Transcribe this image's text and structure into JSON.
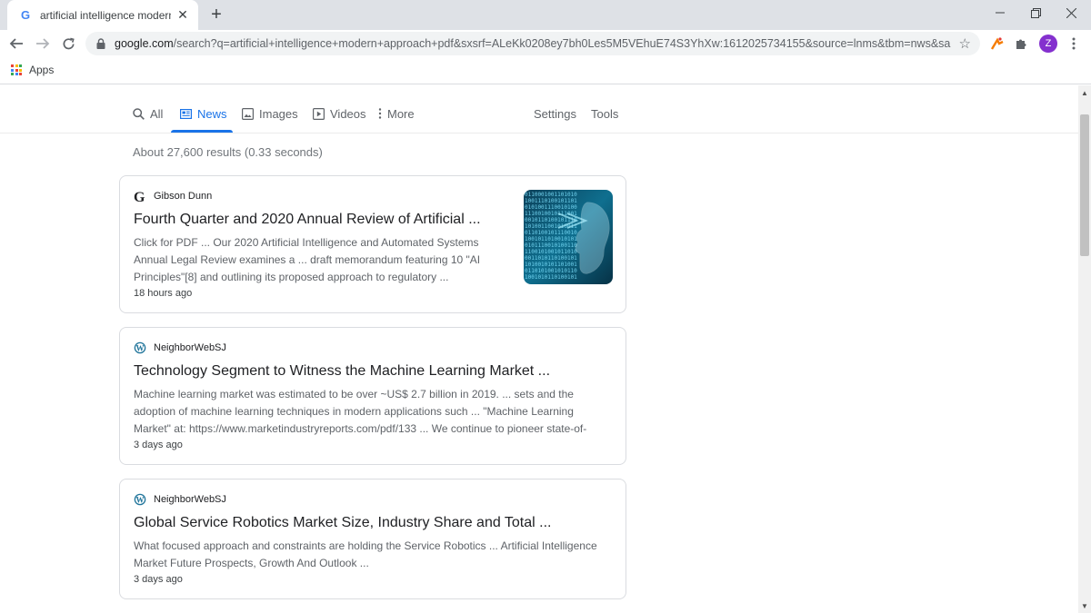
{
  "browser": {
    "tab_title": "artificial intelligence modern app",
    "tab_favicon": "G",
    "url_host": "google.com",
    "url_rest": "/search?q=artificial+intelligence+modern+approach+pdf&sxsrf=ALeKk0208ey7bh0Les5M5VEhuE74S3YhXw:1612025734155&source=lnms&tbm=nws&sa...",
    "avatar_letter": "Z",
    "bookmark_apps": "Apps"
  },
  "search_nav": {
    "items": [
      {
        "label": "All",
        "icon": "search-icon"
      },
      {
        "label": "News",
        "icon": "news-icon"
      },
      {
        "label": "Images",
        "icon": "image-icon"
      },
      {
        "label": "Videos",
        "icon": "play-icon"
      },
      {
        "label": "More",
        "icon": "more-vertical-icon"
      }
    ],
    "settings": "Settings",
    "tools": "Tools",
    "active": "News"
  },
  "results_stats": "About 27,600 results (0.33 seconds)",
  "results": [
    {
      "source": "Gibson Dunn",
      "title": "Fourth Quarter and 2020 Annual Review of Artificial ...",
      "snippet": [
        "Click for PDF ... Our 2020 Artificial Intelligence and Automated Systems",
        "Annual Legal Review examines a ... draft memorandum featuring 10 \"AI",
        "Principles\"[8] and outlining its proposed approach to regulatory ..."
      ],
      "time": "18 hours ago"
    },
    {
      "source": "NeighborWebSJ",
      "title": "Technology Segment to Witness the Machine Learning Market ...",
      "snippet": [
        "Machine learning market was estimated to be over ~US$ 2.7 billion in 2019. ... sets and the",
        "adoption of machine learning techniques in modern applications such ... \"Machine Learning",
        "Market\" at: https://www.marketindustryreports.com/pdf/133 ... We continue to pioneer state-of-"
      ],
      "time": "3 days ago"
    },
    {
      "source": "NeighborWebSJ",
      "title": "Global Service Robotics Market Size, Industry Share and Total ...",
      "snippet": [
        "What focused approach and constraints are holding the Service Robotics ... Artificial Intelligence",
        "Market Future Prospects, Growth And Outlook ..."
      ],
      "time": "3 days ago"
    }
  ],
  "colors": {
    "accent": "#1a73e8",
    "avatar": "#8430ce"
  }
}
